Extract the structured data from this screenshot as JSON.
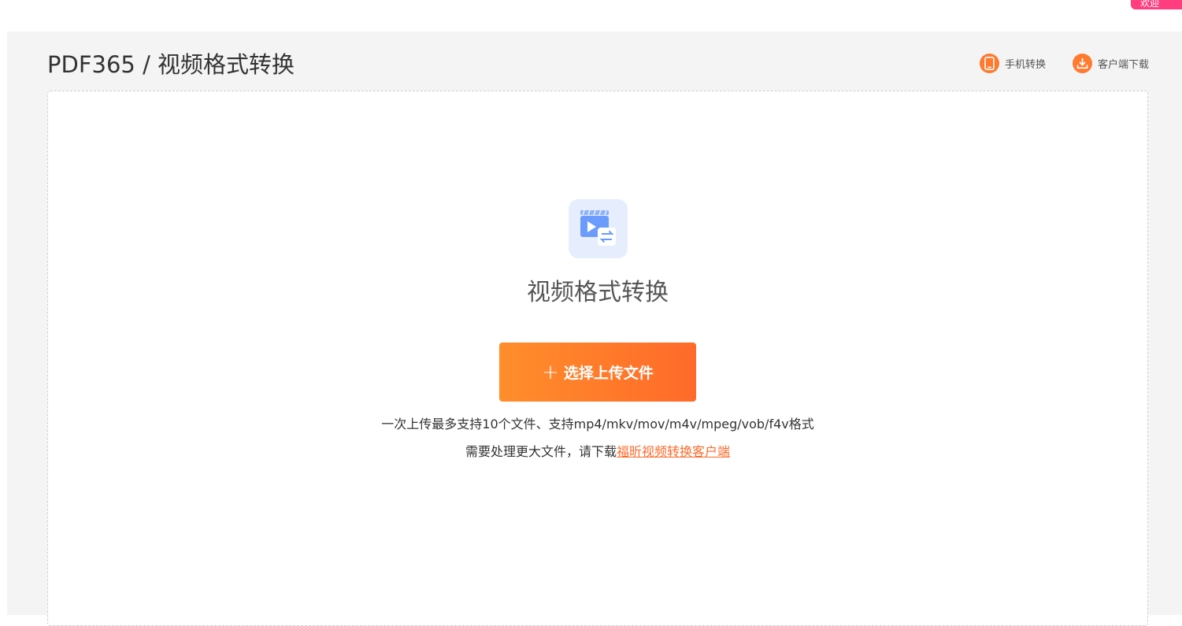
{
  "corner_badge": {
    "label": "欢迎"
  },
  "header": {
    "breadcrumb": "PDF365 / 视频格式转换",
    "links": [
      {
        "label": "手机转换",
        "icon": "phone-icon"
      },
      {
        "label": "客户端下载",
        "icon": "download-icon"
      }
    ]
  },
  "upload": {
    "tool_icon": "video-convert-icon",
    "title": "视频格式转换",
    "button_label": "选择上传文件",
    "hint": "一次上传最多支持10个文件、支持mp4/mkv/mov/m4v/mpeg/vob/f4v格式",
    "large_file_prefix": "需要处理更大文件，请下载",
    "large_file_link": "福昕视频转换客户端"
  },
  "colors": {
    "accent": "#ff7a2e",
    "panel_bg": "#f4f4f4",
    "icon_tile_bg": "#e6eefe",
    "icon_blue": "#6b9bfb"
  }
}
